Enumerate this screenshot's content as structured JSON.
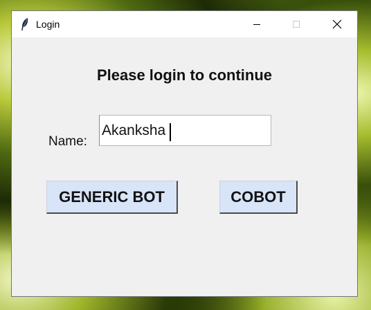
{
  "window": {
    "title": "Login",
    "controls": {
      "minimize": "minimize-icon",
      "maximize": "maximize-icon",
      "close": "close-icon"
    }
  },
  "form": {
    "heading": "Please login to continue",
    "name_label": "Name:",
    "name_value": "Akanksha"
  },
  "buttons": {
    "generic_bot": "GENERIC BOT",
    "cobot": "COBOT"
  },
  "colors": {
    "window_bg": "#f0f0f0",
    "button_bg": "#d8e4f8"
  }
}
